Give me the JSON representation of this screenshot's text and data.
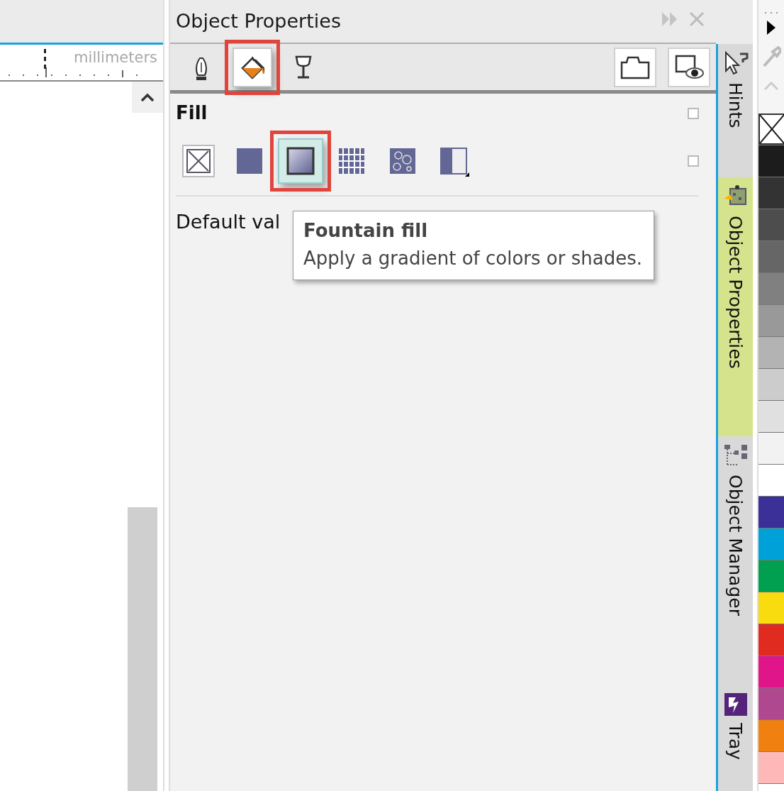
{
  "ruler": {
    "unit": "millimeters"
  },
  "panel": {
    "title": "Object Properties"
  },
  "toolbar_tabs": [
    {
      "kind": "outline",
      "selected": false,
      "annotated": false
    },
    {
      "kind": "fill",
      "selected": true,
      "annotated": true
    },
    {
      "kind": "transparency",
      "selected": false,
      "annotated": false
    }
  ],
  "section": {
    "title": "Fill",
    "checked": false
  },
  "fill_types": {
    "checked": false,
    "items": [
      {
        "kind": "none",
        "selected": false,
        "annotated": false
      },
      {
        "kind": "uniform",
        "selected": false,
        "annotated": false
      },
      {
        "kind": "fountain",
        "selected": true,
        "annotated": true
      },
      {
        "kind": "vector",
        "selected": false,
        "annotated": false
      },
      {
        "kind": "texture",
        "selected": false,
        "annotated": false
      },
      {
        "kind": "twocolor",
        "selected": false,
        "annotated": false
      }
    ]
  },
  "default_text": "Default val",
  "tooltip": {
    "title": "Fountain fill",
    "text": "Apply a gradient of colors or shades."
  },
  "docker_tabs": [
    {
      "label": "Hints",
      "kind": "hints",
      "selected": false
    },
    {
      "label": "Object Properties",
      "kind": "properties",
      "selected": true
    },
    {
      "label": "Object Manager",
      "kind": "manager",
      "selected": false
    },
    {
      "label": "Tray",
      "kind": "tray",
      "selected": false
    }
  ],
  "palette": [
    {
      "kind": "none"
    },
    {
      "color": "#1c1c1c"
    },
    {
      "color": "#333333"
    },
    {
      "color": "#4d4d4d"
    },
    {
      "color": "#666666"
    },
    {
      "color": "#808080"
    },
    {
      "color": "#999999"
    },
    {
      "color": "#b3b3b3"
    },
    {
      "color": "#cccccc"
    },
    {
      "color": "#e0e0e0"
    },
    {
      "color": "#f2f2f2"
    },
    {
      "color": "#ffffff"
    },
    {
      "color": "#3b2f98"
    },
    {
      "color": "#00a0d8"
    },
    {
      "color": "#00a050"
    },
    {
      "color": "#f8dc10"
    },
    {
      "color": "#e02b20"
    },
    {
      "color": "#e0158a"
    },
    {
      "color": "#b04890"
    },
    {
      "color": "#f08010"
    },
    {
      "color": "#ffb8b8"
    }
  ]
}
